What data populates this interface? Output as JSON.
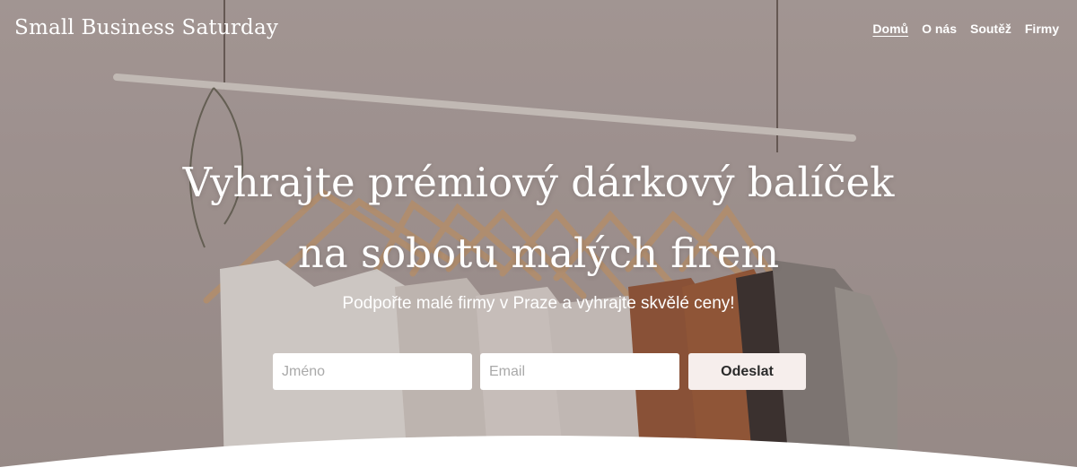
{
  "header": {
    "brand": "Small Business Saturday",
    "nav": [
      {
        "label": "Domů",
        "active": true
      },
      {
        "label": "O nás",
        "active": false
      },
      {
        "label": "Soutěž",
        "active": false
      },
      {
        "label": "Firmy",
        "active": false
      }
    ]
  },
  "hero": {
    "headline_line1": "Vyhrajte prémiový dárkový balíček",
    "headline_line2": "na sobotu malých firem",
    "subtitle": "Podpořte malé firmy v Praze a vyhrajte skvělé ceny!",
    "background_image": "clothing-rack-photo"
  },
  "form": {
    "name_placeholder": "Jméno",
    "email_placeholder": "Email",
    "submit_label": "Odeslat"
  },
  "colors": {
    "hero_tint": "#b1a5a2",
    "button_bg": "#f6eeec",
    "text": "#ffffff"
  }
}
